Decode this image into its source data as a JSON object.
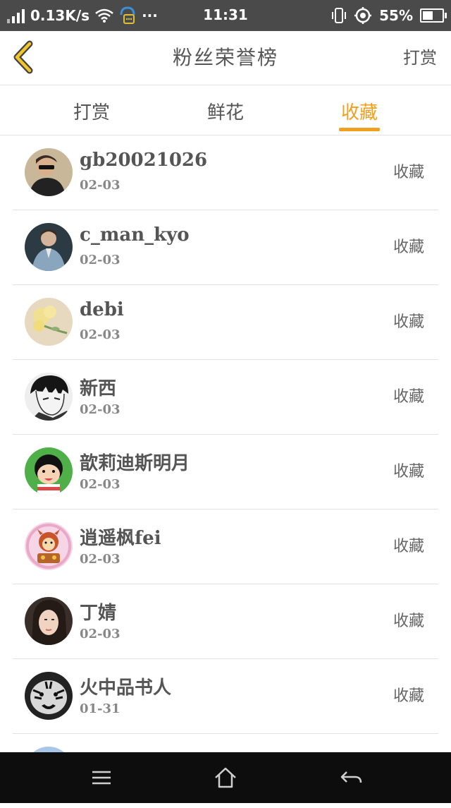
{
  "status_bar": {
    "speed": "0.13K/s",
    "dots": "···",
    "time": "11:31",
    "battery": "55%",
    "battery_level": 0.55
  },
  "header": {
    "title": "粉丝荣誉榜",
    "right_action": "打赏"
  },
  "tabs": [
    {
      "label": "打赏",
      "active": false
    },
    {
      "label": "鲜花",
      "active": false
    },
    {
      "label": "收藏",
      "active": true
    }
  ],
  "accent_color": "#f0a01e",
  "entries": [
    {
      "name": "gb20021026",
      "date": "02-03",
      "action": "收藏",
      "avatar": "person-sunglasses"
    },
    {
      "name": "c_man_kyo",
      "date": "02-03",
      "action": "收藏",
      "avatar": "person-man"
    },
    {
      "name": "debi",
      "date": "02-03",
      "action": "收藏",
      "avatar": "flower"
    },
    {
      "name": "新西",
      "date": "02-03",
      "action": "收藏",
      "avatar": "anime-boy"
    },
    {
      "name": "歆莉迪斯明月",
      "date": "02-03",
      "action": "收藏",
      "avatar": "cartoon-girl"
    },
    {
      "name": "逍遥枫fei",
      "date": "02-03",
      "action": "收藏",
      "avatar": "cartoon-monkey"
    },
    {
      "name": "丁婧",
      "date": "02-03",
      "action": "收藏",
      "avatar": "person-woman"
    },
    {
      "name": "火中品书人",
      "date": "01-31",
      "action": "收藏",
      "avatar": "tiger"
    }
  ]
}
